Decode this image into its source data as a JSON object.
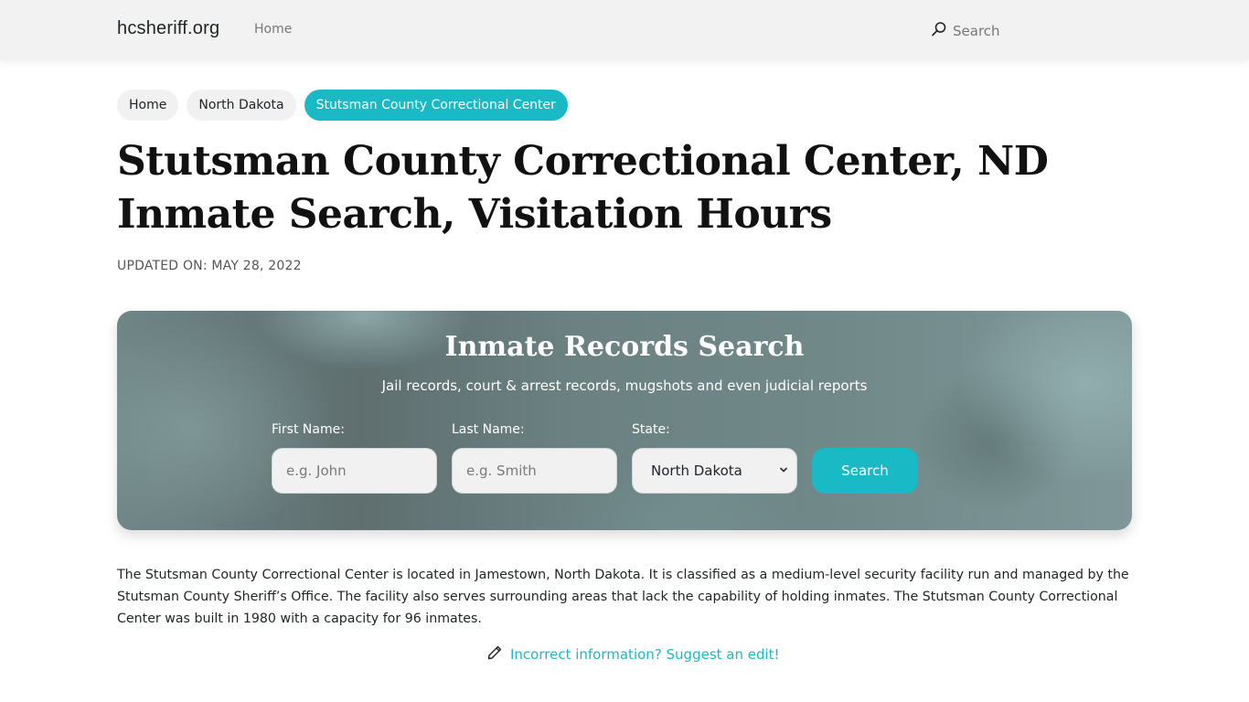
{
  "navbar": {
    "brand": "hcsheriff.org",
    "links": [
      {
        "label": "Home"
      }
    ],
    "search_label": "Search",
    "search_icon": "search-icon"
  },
  "breadcrumbs": [
    {
      "label": "Home",
      "active": false
    },
    {
      "label": "North Dakota",
      "active": false
    },
    {
      "label": "Stutsman County Correctional Center",
      "active": true
    }
  ],
  "page": {
    "title_line1": "Stutsman County Correctional Center, ND",
    "title_line2": "Inmate Search, Visitation Hours",
    "updated": "UPDATED ON: MAY 28, 2022"
  },
  "search_card": {
    "title": "Inmate Records Search",
    "subtitle": "Jail records, court & arrest records, mugshots and even judicial reports",
    "first_name": {
      "label": "First Name:",
      "placeholder": "e.g. John",
      "value": ""
    },
    "last_name": {
      "label": "Last Name:",
      "placeholder": "e.g. Smith",
      "value": ""
    },
    "state": {
      "label": "State:",
      "selected": "North Dakota"
    },
    "button_label": "Search",
    "accent_color": "#1ab9c6"
  },
  "description": "The Stutsman County Correctional Center is located in Jamestown, North Dakota. It is classified as a medium-level security facility run and managed by the Stutsman County Sheriff’s Office. The facility also serves surrounding areas that lack the capability of holding inmates. The Stutsman County Correctional Center was built in 1980 with a capacity for 96 inmates.",
  "suggest_edit": {
    "label": "Incorrect information? Suggest an edit!",
    "icon": "pencil-icon"
  }
}
